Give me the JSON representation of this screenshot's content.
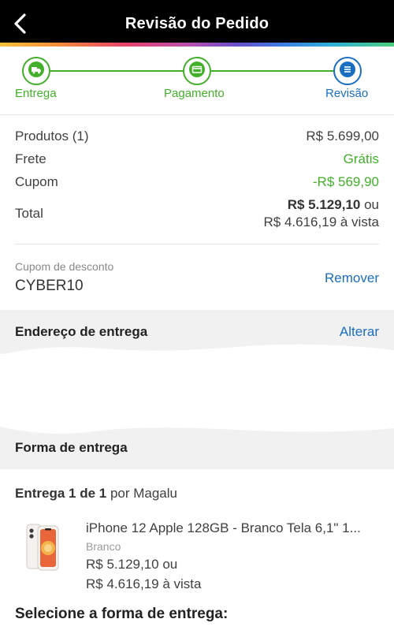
{
  "header": {
    "title": "Revisão do Pedido"
  },
  "stepper": {
    "steps": [
      {
        "label": "Entrega",
        "icon": "truck-icon",
        "color": "#43b02a"
      },
      {
        "label": "Pagamento",
        "icon": "credit-card-icon",
        "color": "#43b02a"
      },
      {
        "label": "Revisão",
        "icon": "list-icon",
        "color": "#1a6ec1"
      }
    ]
  },
  "summary": {
    "products_label": "Produtos (1)",
    "products_value": "R$ 5.699,00",
    "shipping_label": "Frete",
    "shipping_value": "Grátis",
    "coupon_label": "Cupom",
    "coupon_value": "-R$ 569,90",
    "total_label": "Total",
    "total_value": "R$ 5.129,10",
    "total_suffix": " ou",
    "total_cash": "R$ 4.616,19 à vista"
  },
  "coupon": {
    "label": "Cupom de desconto",
    "code": "CYBER10",
    "remove_label": "Remover"
  },
  "address": {
    "title": "Endereço de entrega",
    "change_label": "Alterar"
  },
  "delivery": {
    "title": "Forma de entrega",
    "count_prefix": "Entrega 1 de 1",
    "count_suffix": " por Magalu",
    "select_title": "Selecione a forma de entrega:"
  },
  "product": {
    "name": "iPhone 12 Apple 128GB - Branco Tela 6,1\" 1...",
    "variant": "Branco",
    "price_line": "R$ 5.129,10 ou",
    "cash_line": "R$ 4.616,19 à vista"
  },
  "colors": {
    "green": "#43b02a",
    "blue": "#1a6ec1"
  }
}
